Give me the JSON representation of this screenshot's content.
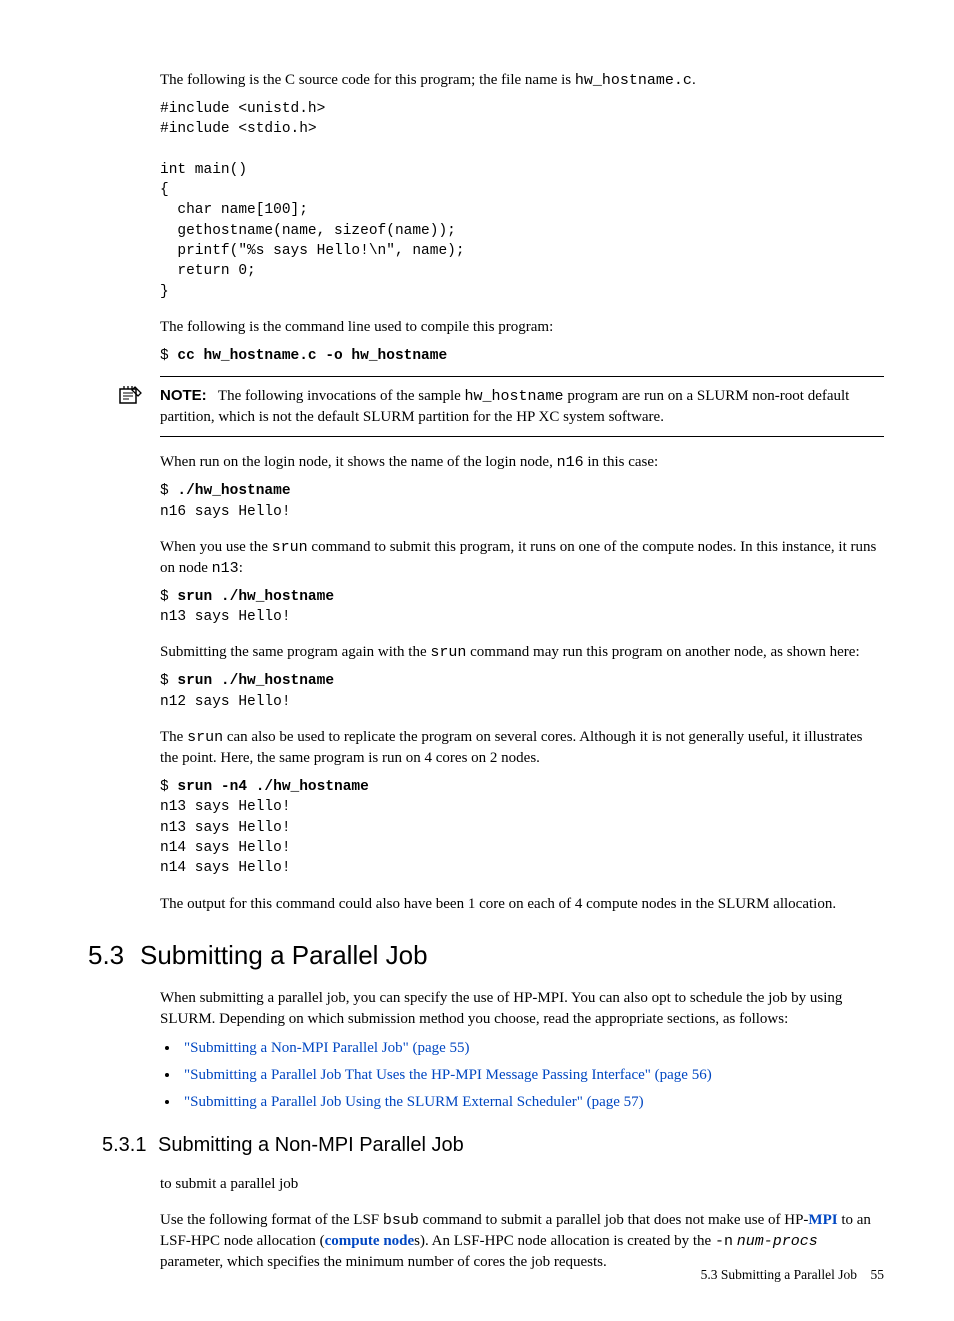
{
  "intro": {
    "p1a": "The following is the C source code for this program; the file name is ",
    "p1code": "hw_hostname.c",
    "p1b": "."
  },
  "code1": "#include <unistd.h>\n#include <stdio.h>\n\nint main()\n{\n  char name[100];\n  gethostname(name, sizeof(name));\n  printf(\"%s says Hello!\\n\", name);\n  return 0;\n}",
  "p2": "The following is the command line used to compile this program:",
  "code2_prompt": "$ ",
  "code2_cmd": "cc hw_hostname.c -o hw_hostname",
  "note": {
    "label": "NOTE:",
    "t1": "The following invocations of the sample ",
    "t1code": "hw_hostname",
    "t2": " program are run on a SLURM non-root default partition, which is not the default SLURM partition for the HP XC system software."
  },
  "p3": {
    "a": "When run on the login node, it shows the name of the login node, ",
    "code": "n16",
    "b": " in this case:"
  },
  "code3_prompt": "$ ",
  "code3_cmd": "./hw_hostname",
  "code3_out": "n16 says Hello!",
  "p4": {
    "a": "When you use the ",
    "code1": "srun",
    "b": " command to submit this program, it runs on one of the compute nodes. In this instance, it runs on node ",
    "code2": "n13",
    "c": ":"
  },
  "code4_prompt": "$ ",
  "code4_cmd": "srun ./hw_hostname",
  "code4_out": "n13 says Hello!",
  "p5": {
    "a": "Submitting the same program again with the ",
    "code": "srun",
    "b": " command may run this program on another node, as shown here:"
  },
  "code5_prompt": "$ ",
  "code5_cmd": "srun ./hw_hostname",
  "code5_out": "n12 says Hello!",
  "p6": {
    "a": "The ",
    "code": "srun",
    "b": " can also be used to replicate the program on several cores. Although it is not generally useful, it illustrates the point. Here, the same program is run on 4 cores on 2 nodes."
  },
  "code6_prompt": "$ ",
  "code6_cmd": "srun -n4 ./hw_hostname",
  "code6_out": "n13 says Hello!\nn13 says Hello!\nn14 says Hello!\nn14 says Hello!",
  "p7": "The output for this command could also have been 1 core on each of 4 compute nodes in the SLURM allocation.",
  "h2": {
    "num": "5.3",
    "title": "Submitting a Parallel Job"
  },
  "p8": "When submitting a parallel job, you can specify the use of HP-MPI. You can also opt to schedule the job by using SLURM. Depending on which submission method you choose, read the appropriate sections, as follows:",
  "links": [
    "\"Submitting a Non-MPI Parallel Job\" (page 55)",
    "\"Submitting a Parallel Job That Uses the HP-MPI Message Passing Interface\" (page 56)",
    "\"Submitting a Parallel Job Using the SLURM External Scheduler\" (page 57)"
  ],
  "h3": {
    "num": "5.3.1",
    "title": "Submitting a Non-MPI Parallel Job"
  },
  "p9": "to submit a parallel job",
  "p10": {
    "a": "Use the following format of the LSF ",
    "code1": "bsub",
    "b": " command to submit a parallel job that does not make use of HP-",
    "link1": "MPI",
    "c": " to an LSF-HPC node allocation (",
    "link2": "compute node",
    "d": "s). An LSF-HPC node allocation is created by the ",
    "code2": "-n",
    "e": " ",
    "code3": "num-procs",
    "f": " parameter, which specifies the minimum number of cores the job requests."
  },
  "footer": {
    "section": "5.3 Submitting a Parallel Job",
    "page": "55"
  }
}
